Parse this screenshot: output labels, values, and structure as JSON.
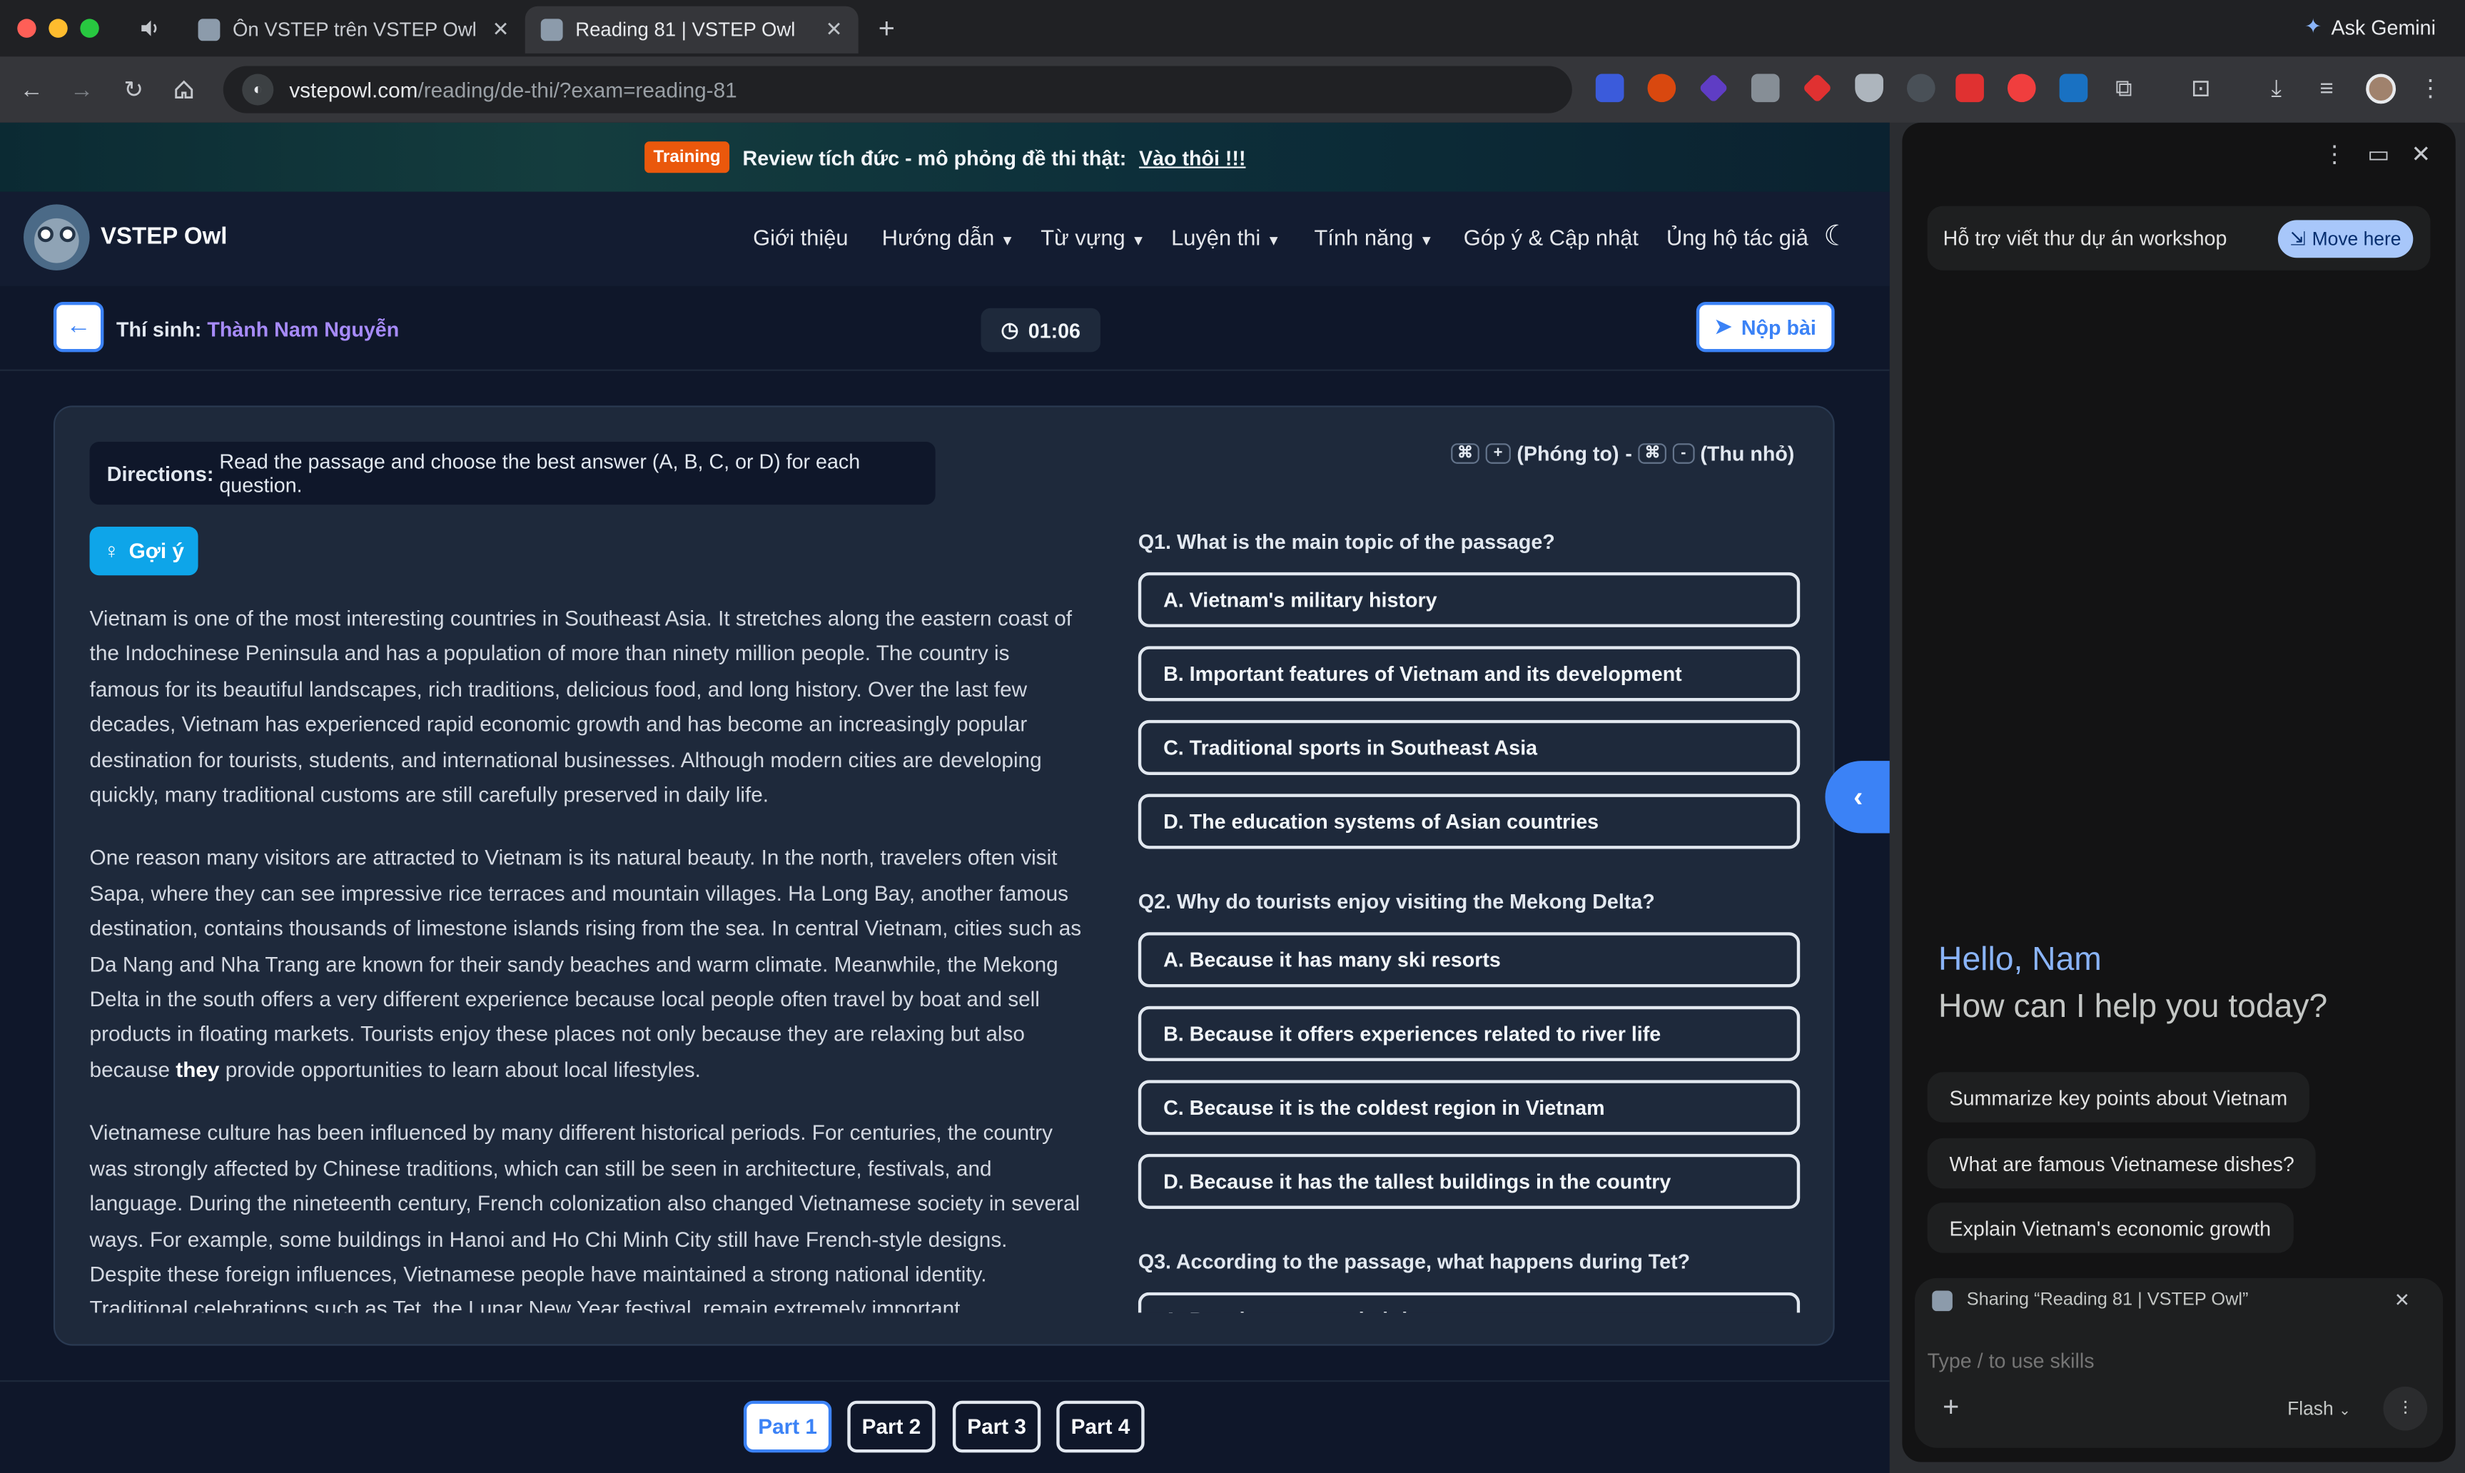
{
  "browser": {
    "tabs": [
      {
        "title": "Ôn VSTEP trên VSTEP Owl bằ"
      },
      {
        "title": "Reading 81 | VSTEP Owl"
      }
    ],
    "url_domain": "vstepowl.com",
    "url_path": "/reading/de-thi/?exam=reading-81",
    "ask_gemini": "Ask Gemini",
    "icons": [
      "back-icon",
      "forward-icon",
      "reload-icon",
      "home-icon",
      "site-info-icon",
      "new-tab-icon",
      "download-icon",
      "sidebar-icon",
      "profile-icon",
      "more-icon"
    ]
  },
  "banner": {
    "badge": "Training",
    "text": "Review tích đức - mô phỏng đề thi thật:",
    "link": "Vào thôi !!!"
  },
  "nav": {
    "brand": "VSTEP Owl",
    "items": [
      {
        "label": "Giới thiệu"
      },
      {
        "label": "Hướng dẫn"
      },
      {
        "label": "Từ vựng"
      },
      {
        "label": "Luyện thi"
      },
      {
        "label": "Tính năng"
      },
      {
        "label": "Góp ý & Cập nhật"
      },
      {
        "label": "Ủng hộ tác giả"
      }
    ]
  },
  "exam": {
    "candidate_label": "Thí sinh:",
    "candidate_name": "Thành Nam Nguyễn",
    "timer": "01:06",
    "submit": "Nộp bài",
    "directions_label": "Directions:",
    "directions_text": "Read the passage and choose the best answer (A, B, C, or D) for each question.",
    "zoom_in": "(Phóng to)",
    "zoom_sep": "-",
    "zoom_out": "(Thu nhỏ)",
    "hint": "Gợi ý"
  },
  "passage": {
    "p1": "Vietnam is one of the most interesting countries in Southeast Asia. It stretches along the eastern coast of the Indochinese Peninsula and has a population of more than ninety million people. The country is famous for its beautiful landscapes, rich traditions, delicious food, and long history. Over the last few decades, Vietnam has experienced rapid economic growth and has become an increasingly popular destination for tourists, students, and international businesses. Although modern cities are developing quickly, many traditional customs are still carefully preserved in daily life.",
    "p2a": "One reason many visitors are attracted to Vietnam is its natural beauty. In the north, travelers often visit Sapa, where they can see impressive rice terraces and mountain villages. Ha Long Bay, another famous destination, contains thousands of limestone islands rising from the sea. In central Vietnam, cities such as Da Nang and Nha Trang are known for their sandy beaches and warm climate. Meanwhile, the Mekong Delta in the south offers a very different experience because local people often travel by boat and sell products in floating markets. Tourists enjoy these places not only because they are relaxing but also because",
    "p2_bold": "they",
    "p2b": "provide opportunities to learn about local lifestyles.",
    "p3": "Vietnamese culture has been influenced by many different historical periods. For centuries, the country was strongly affected by Chinese traditions, which can still be seen in architecture, festivals, and language. During the nineteenth century, French colonization also changed Vietnamese society in several ways. For example, some buildings in Hanoi and Ho Chi Minh City still have French-style designs. Despite these foreign influences, Vietnamese people have maintained a strong national identity. Traditional celebrations such as Tet, the Lunar New Year festival, remain extremely important."
  },
  "questions": [
    {
      "q": "Q1. What is the main topic of the passage?",
      "options": [
        "A. Vietnam's military history",
        "B. Important features of Vietnam and its development",
        "C. Traditional sports in Southeast Asia",
        "D. The education systems of Asian countries"
      ]
    },
    {
      "q": "Q2. Why do tourists enjoy visiting the Mekong Delta?",
      "options": [
        "A. Because it has many ski resorts",
        "B. Because it offers experiences related to river life",
        "C. Because it is the coldest region in Vietnam",
        "D. Because it has the tallest buildings in the country"
      ]
    },
    {
      "q": "Q3. According to the passage, what happens during Tet?",
      "options": [
        "A. People return to their hometowns"
      ]
    }
  ],
  "parts": [
    "Part 1",
    "Part 2",
    "Part 3",
    "Part 4"
  ],
  "gemini": {
    "context_title": "Hỗ trợ viết thư dự án workshop",
    "move_here": "Move here",
    "hello": "Hello, Nam",
    "help": "How can I help you today?",
    "suggestions": [
      "Summarize key points about Vietnam",
      "What are famous Vietnamese dishes?",
      "Explain Vietnam's economic growth"
    ],
    "sharing": "Sharing “Reading 81 | VSTEP Owl”",
    "placeholder": "Type / to use skills",
    "model": "Flash"
  },
  "colors": {
    "accent": "#3b82f6",
    "candidate": "#a78bfa",
    "training": "#ea580c",
    "gemini_blue": "#8ab4f8"
  }
}
